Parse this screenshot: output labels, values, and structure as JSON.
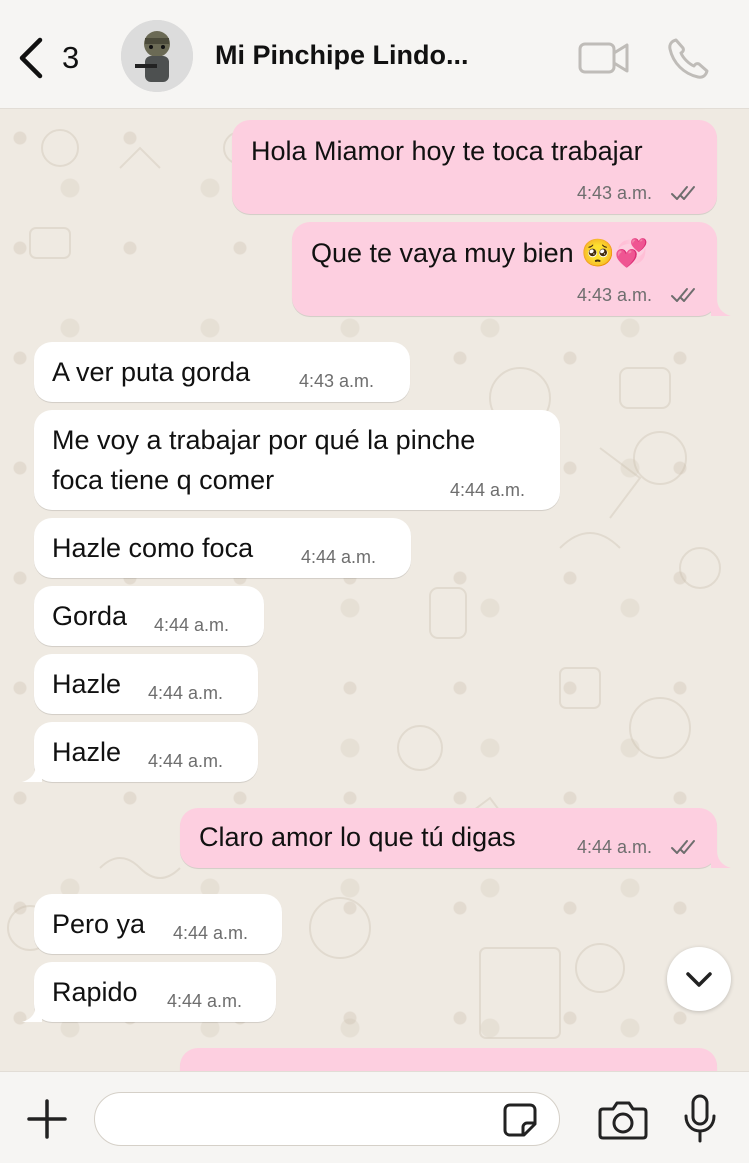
{
  "header": {
    "back_count": "3",
    "contact_name": "Mi Pinchipe Lindo..."
  },
  "messages": [
    {
      "dir": "out",
      "text": "Hola Miamor hoy te toca trabajar",
      "time": "4:43 a.m.",
      "status": "read"
    },
    {
      "dir": "out",
      "text": "Que te vaya muy bien 🥺💞",
      "time": "4:43 a.m.",
      "status": "read"
    },
    {
      "dir": "in",
      "text": "A ver puta gorda",
      "time": "4:43 a.m."
    },
    {
      "dir": "in",
      "text_line1": "Me voy a trabajar por qué la pinche",
      "text_line2": "foca tiene q comer",
      "time": "4:44 a.m."
    },
    {
      "dir": "in",
      "text": "Hazle como foca",
      "time": "4:44 a.m."
    },
    {
      "dir": "in",
      "text": "Gorda",
      "time": "4:44 a.m."
    },
    {
      "dir": "in",
      "text": "Hazle",
      "time": "4:44 a.m."
    },
    {
      "dir": "in",
      "text": "Hazle",
      "time": "4:44 a.m."
    },
    {
      "dir": "out",
      "text": "Claro amor lo que tú digas",
      "time": "4:44 a.m.",
      "status": "read"
    },
    {
      "dir": "in",
      "text": "Pero ya",
      "time": "4:44 a.m."
    },
    {
      "dir": "in",
      "text": "Rapido",
      "time": "4:44 a.m."
    }
  ],
  "composer": {
    "value": "",
    "placeholder": ""
  },
  "colors": {
    "outgoing_bubble": "#fdcfe0",
    "incoming_bubble": "#ffffff",
    "chat_background": "#efeae2"
  },
  "icons": [
    "back-chevron-icon",
    "video-call-icon",
    "phone-icon",
    "chevron-down-icon",
    "plus-icon",
    "sticker-icon",
    "camera-icon",
    "microphone-icon",
    "double-check-icon"
  ]
}
